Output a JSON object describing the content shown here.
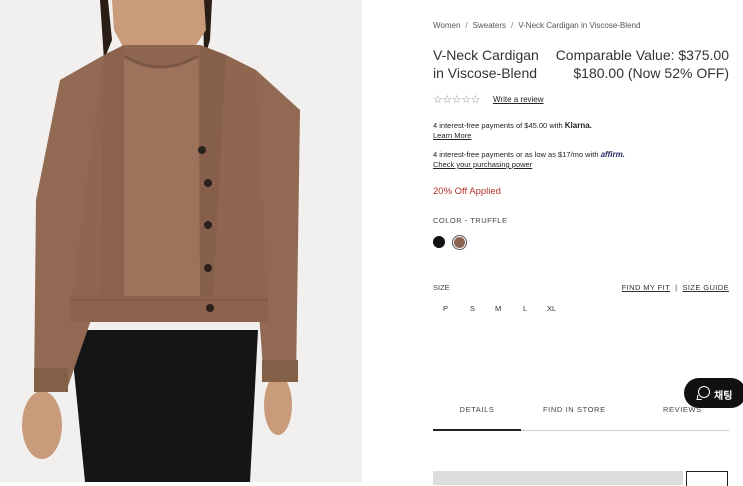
{
  "breadcrumb": [
    "Women",
    "Sweaters",
    "V-Neck Cardigan in Viscose-Blend"
  ],
  "breadcrumb_sep": "/",
  "product": {
    "title_line1": "V-Neck Cardigan",
    "title_line2": "in Viscose-Blend",
    "comparable_value": "Comparable Value: $375.00",
    "sale_price": "$180.00 (Now 52% OFF)"
  },
  "reviews": {
    "stars": "☆☆☆☆☆",
    "write_link": "Write a review"
  },
  "klarna": {
    "text": "4 interest-free payments of $45.00 with",
    "brand": "Klarna.",
    "learn_more": "Learn More"
  },
  "affirm": {
    "text": "4 interest-free payments or as low as $17/mo with",
    "brand": "affirm.",
    "link": "Check your purchasing power"
  },
  "promo": "20% Off Applied",
  "color": {
    "label": "COLOR - TRUFFLE",
    "swatches": [
      {
        "name": "black",
        "hex": "#111111"
      },
      {
        "name": "truffle",
        "hex": "#8a6450"
      }
    ],
    "selected": "truffle"
  },
  "size": {
    "label": "SIZE",
    "find_fit": "FIND MY FIT",
    "divider": "|",
    "size_guide": "SIZE GUIDE",
    "options": [
      "P",
      "S",
      "M",
      "L",
      "XL"
    ]
  },
  "tabs": [
    "DETAILS",
    "FIND IN STORE",
    "REVIEWS"
  ],
  "active_tab": "DETAILS",
  "chat": {
    "label": "채팅",
    "icon": "chat-bubble-icon"
  },
  "colors": {
    "promo": "#b3312c",
    "swatch_truffle": "#8a6450"
  }
}
